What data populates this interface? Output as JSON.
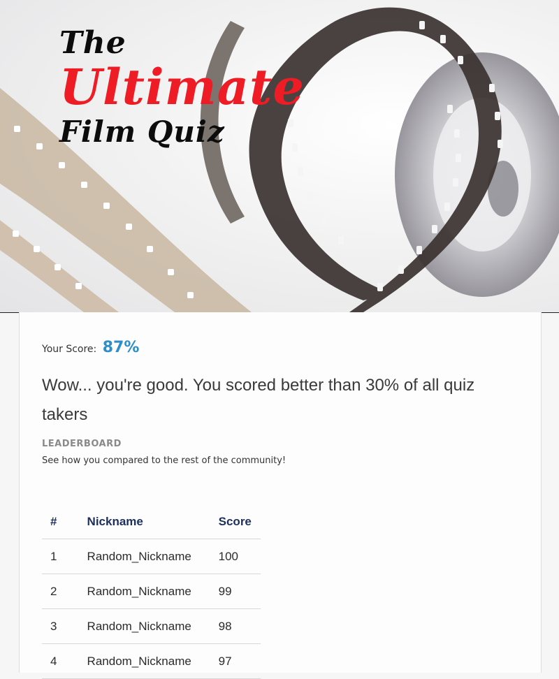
{
  "hero": {
    "title_line1": "The",
    "title_line2": "Ultimate",
    "title_line3": "Film Quiz",
    "image": "film-strip-reel-photo"
  },
  "result": {
    "score_label": "Your Score:",
    "score_value": "87%",
    "message": "Wow... you're good. You scored better than 30% of all quiz takers"
  },
  "leaderboard": {
    "title": "LEADERBOARD",
    "subtitle": "See how you compared to the rest of the community!",
    "columns": [
      "#",
      "Nickname",
      "Score"
    ],
    "rows": [
      {
        "rank": "1",
        "nickname": "Random_Nickname",
        "score": "100"
      },
      {
        "rank": "2",
        "nickname": "Random_Nickname",
        "score": "99"
      },
      {
        "rank": "3",
        "nickname": "Random_Nickname",
        "score": "98"
      },
      {
        "rank": "4",
        "nickname": "Random_Nickname",
        "score": "97"
      }
    ]
  },
  "colors": {
    "title_red": "#ee1c24",
    "score_blue": "#2e8ec9",
    "header_navy": "#1d2f5c"
  }
}
